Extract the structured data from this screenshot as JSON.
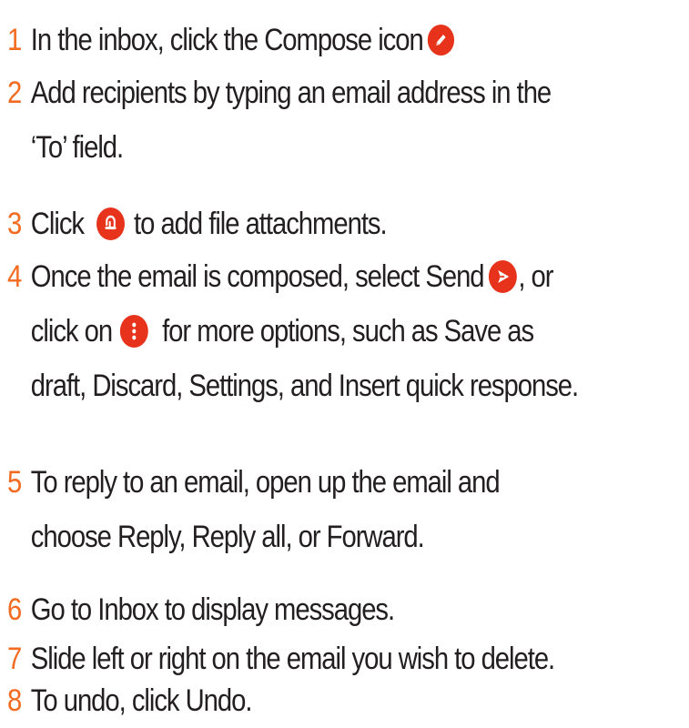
{
  "colors": {
    "step_number": "#f26b21",
    "icon_fill": "#e8331c",
    "text": "#231f20"
  },
  "steps": [
    {
      "number": "1",
      "lines": [
        {
          "before": "In the inbox, click the Compose icon",
          "icon": "pencil-icon",
          "after": ""
        }
      ]
    },
    {
      "number": "2",
      "lines": [
        {
          "before": "Add recipients by typing an email address in the"
        },
        {
          "before": "‘To’ field."
        }
      ]
    },
    {
      "number": "3",
      "lines": [
        {
          "before": "Click",
          "icon": "paperclip-icon",
          "after": "to add file attachments."
        }
      ]
    },
    {
      "number": "4",
      "lines": [
        {
          "before": "Once the email is composed, select Send",
          "icon": "send-icon",
          "after": ", or"
        },
        {
          "before": "click on",
          "icon": "more-options-icon",
          "after": "for more options, such as Save as"
        },
        {
          "before": "draft, Discard, Settings, and Insert quick response."
        }
      ]
    },
    {
      "number": "5",
      "lines": [
        {
          "before": "To reply to an email, open up the email and"
        },
        {
          "before": "choose Reply, Reply all, or Forward."
        }
      ]
    },
    {
      "number": "6",
      "lines": [
        {
          "before": "Go to Inbox to display messages."
        }
      ]
    },
    {
      "number": "7",
      "lines": [
        {
          "before": "Slide left or right on the email you wish to delete."
        }
      ]
    },
    {
      "number": "8",
      "lines": [
        {
          "before": "To undo, click Undo."
        }
      ]
    }
  ]
}
